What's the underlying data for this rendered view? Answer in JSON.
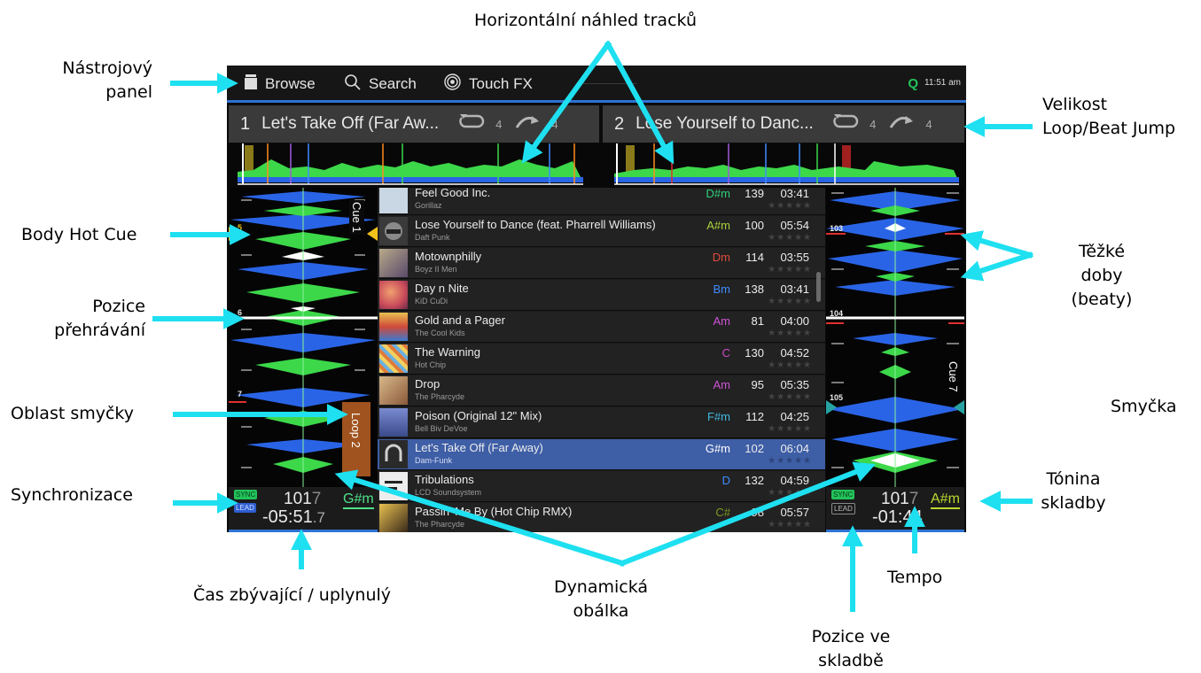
{
  "callouts": {
    "overview": "Horizontální náhled tracků",
    "toolbar": [
      "Nástrojový",
      "panel"
    ],
    "loop_size": [
      "Velikost",
      "Loop/Beat Jump"
    ],
    "hot_cue": "Body Hot Cue",
    "downbeats": [
      "Těžké",
      "doby",
      "(beaty)"
    ],
    "play_position": [
      "Pozice",
      "přehrávání"
    ],
    "loop_area": "Oblast smyčky",
    "loop": "Smyčka",
    "sync": "Synchronizace",
    "key": [
      "Tónina",
      "skladby"
    ],
    "tempo": "Tempo",
    "time": "Čas zbývající / uplynulý",
    "envelope": [
      "Dynamická",
      "obálka"
    ],
    "track_position": [
      "Pozice ve",
      "skladbě"
    ]
  },
  "toolbar": {
    "browse": "Browse",
    "search": "Search",
    "touch_fx": "Touch FX",
    "q": "Q",
    "clock": "11:51 am"
  },
  "deck1": {
    "number": "1",
    "title": "Let's Take Off (Far Aw...",
    "loop_size": "4",
    "jump_size": "4",
    "hot_cue_numbers": [
      "5",
      "6",
      "7"
    ],
    "cue_label": "Cue 1",
    "loop_label": "Loop 2",
    "sync": "SYNC",
    "lead": "LEAD",
    "bpm_main": "101",
    "bpm_decimal": "7",
    "time_main": "-05:51",
    "time_decimal": ".7",
    "key": "G#m",
    "key_color": "#4ee08a"
  },
  "deck2": {
    "number": "2",
    "title": "Lose Yourself to Danc...",
    "loop_size": "4",
    "jump_size": "4",
    "beat_numbers": [
      "103",
      "104",
      "105"
    ],
    "cue_label": "Cue 7",
    "sync": "SYNC",
    "lead": "LEAD",
    "bpm_main": "101",
    "bpm_decimal": "7",
    "time": "-01:4",
    "time_tail": "4",
    "key": "A#m",
    "key_color": "#b8d82e"
  },
  "tracks": [
    {
      "title": "Feel Good Inc.",
      "artist": "Gorillaz",
      "key": "D#m",
      "key_color": "#2fd07a",
      "bpm": "139",
      "duration": "03:41",
      "stars": "★★★★★",
      "art": "#c9d6e3"
    },
    {
      "title": "Lose Yourself to Dance (feat. Pharrell Williams)",
      "artist": "Daft Punk",
      "key": "A#m",
      "key_color": "#a9d13a",
      "bpm": "100",
      "duration": "05:54",
      "stars": "★★★★★",
      "art": "#4a4a4a"
    },
    {
      "title": "Motownphilly",
      "artist": "Boyz II Men",
      "key": "Dm",
      "key_color": "#e04a3c",
      "bpm": "114",
      "duration": "03:55",
      "stars": "★★★★★",
      "art": "#7a6f8f"
    },
    {
      "title": "Day n Nite",
      "artist": "KiD CuDi",
      "key": "Bm",
      "key_color": "#3e8cff",
      "bpm": "138",
      "duration": "03:41",
      "stars": "★★★★★",
      "art": "#c84a5a"
    },
    {
      "title": "Gold and a Pager",
      "artist": "The Cool Kids",
      "key": "Am",
      "key_color": "#d052d8",
      "bpm": "81",
      "duration": "04:00",
      "stars": "★★★★★",
      "art": "#d9a340"
    },
    {
      "title": "The Warning",
      "artist": "Hot Chip",
      "key": "C",
      "key_color": "#d047c8",
      "bpm": "130",
      "duration": "04:52",
      "stars": "★★★★★",
      "art": "#e6c25a"
    },
    {
      "title": "Drop",
      "artist": "The Pharcyde",
      "key": "Am",
      "key_color": "#d052d8",
      "bpm": "95",
      "duration": "05:35",
      "stars": "★★★★★",
      "art": "#b58a5a"
    },
    {
      "title": "Poison (Original 12\" Mix)",
      "artist": "Bell Biv DeVoe",
      "key": "F#m",
      "key_color": "#3fb8e0",
      "bpm": "112",
      "duration": "04:25",
      "stars": "★★★★★",
      "art": "#5a6aa8"
    },
    {
      "title": "Let's Take Off (Far Away)",
      "artist": "Dam-Funk",
      "key": "G#m",
      "key_color": "#ffffff",
      "bpm": "102",
      "duration": "06:04",
      "stars": "★★★★★",
      "art": "#2a2a2a",
      "selected": true
    },
    {
      "title": "Tribulations",
      "artist": "LCD Soundsystem",
      "key": "D",
      "key_color": "#3e8cff",
      "bpm": "132",
      "duration": "04:59",
      "stars": "★★★★★",
      "art": "#eeeeee"
    },
    {
      "title": "Passin' Me By (Hot Chip RMX)",
      "artist": "The Pharcyde",
      "key": "C#",
      "key_color": "#7a9a20",
      "bpm": "98",
      "duration": "05:57",
      "stars": "★★★★★",
      "art": "#8a6a2a"
    }
  ],
  "colors": {
    "accent_blue": "#2d72d2",
    "pointer": "#1ee0f0",
    "wave_green": "#3cd84a",
    "wave_blue": "#2a64e6",
    "loop_orange": "#a0531f"
  }
}
